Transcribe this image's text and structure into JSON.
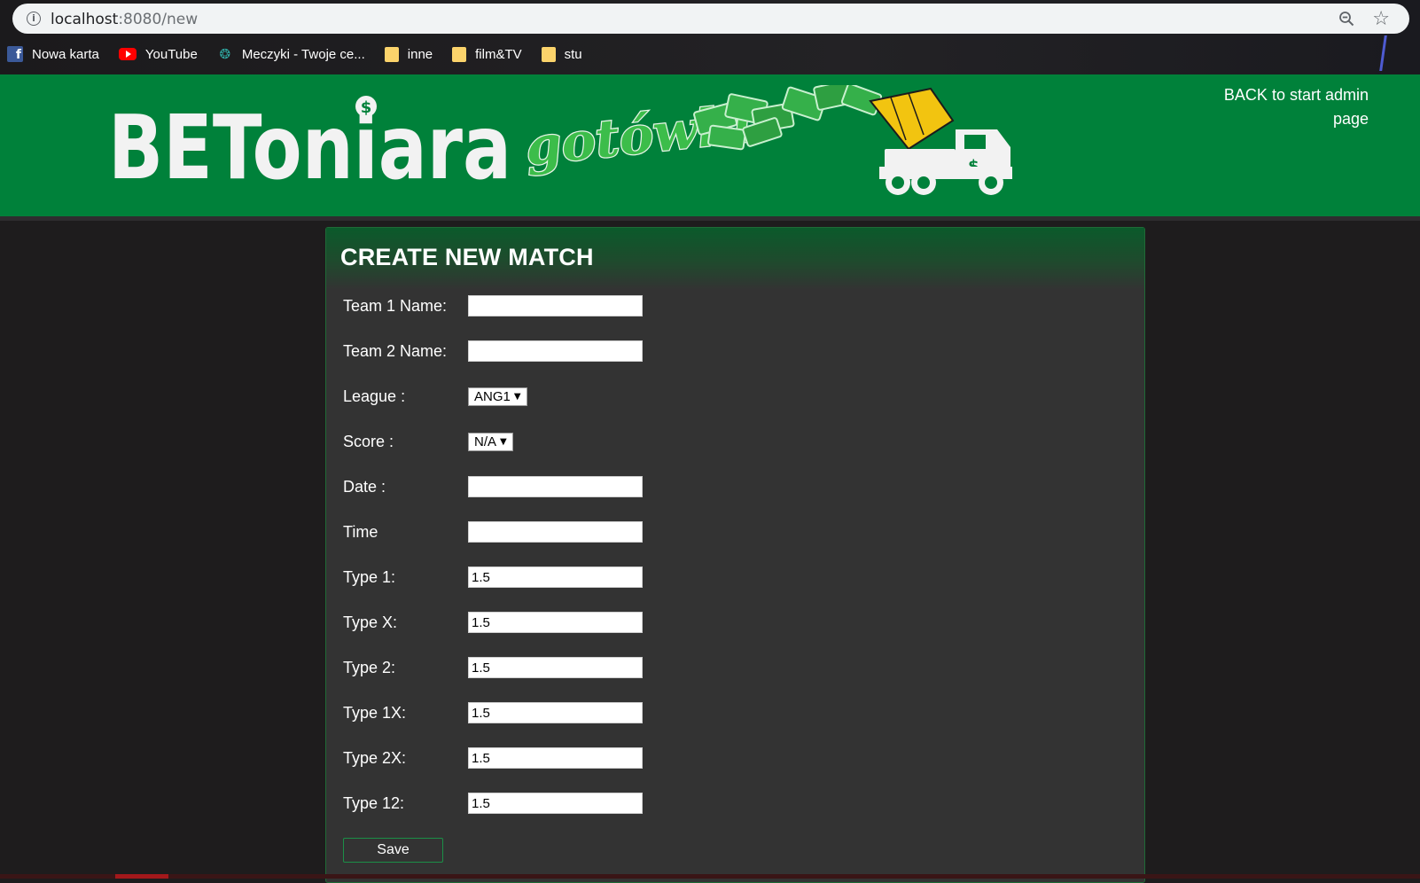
{
  "browser": {
    "url_host": "localhost",
    "url_path": ":8080/new",
    "bookmarks": [
      {
        "label": "Nowa karta",
        "icon": "facebook-icon"
      },
      {
        "label": "YouTube",
        "icon": "youtube-icon"
      },
      {
        "label": "Meczyki - Twoje ce...",
        "icon": "meczyki-icon"
      },
      {
        "label": "inne",
        "icon": "folder-icon"
      },
      {
        "label": "film&TV",
        "icon": "folder-icon"
      },
      {
        "label": "stu",
        "icon": "folder-icon"
      }
    ]
  },
  "header": {
    "logo_main": "BEToniara",
    "logo_script": "gotówki",
    "back_link": "BACK to start admin page",
    "colors": {
      "header_bg": "#00813a",
      "truck_drum": "#f2c410",
      "money": "#3cb44a"
    }
  },
  "form": {
    "title": "CREATE NEW MATCH",
    "fields": {
      "team1": {
        "label": "Team 1 Name:",
        "value": ""
      },
      "team2": {
        "label": "Team 2 Name:",
        "value": ""
      },
      "league": {
        "label": "League :",
        "value": "ANG1"
      },
      "score": {
        "label": "Score :",
        "value": "N/A"
      },
      "date": {
        "label": "Date :",
        "value": ""
      },
      "time": {
        "label": "Time",
        "value": ""
      },
      "type1": {
        "label": "Type 1:",
        "value": "1.5"
      },
      "typeX": {
        "label": "Type X:",
        "value": "1.5"
      },
      "type2": {
        "label": "Type 2:",
        "value": "1.5"
      },
      "type1X": {
        "label": "Type 1X:",
        "value": "1.5"
      },
      "type2X": {
        "label": "Type 2X:",
        "value": "1.5"
      },
      "type12": {
        "label": "Type 12:",
        "value": "1.5"
      }
    },
    "save_label": "Save"
  }
}
